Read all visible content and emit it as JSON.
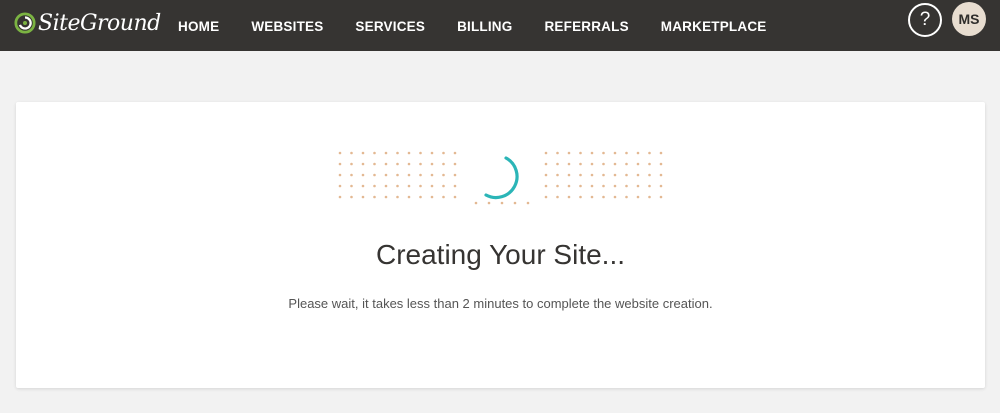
{
  "brand": {
    "name": "SiteGround",
    "logo_icon": "siteground-swirl-icon",
    "accent_color": "#7bb342"
  },
  "nav": {
    "items": [
      {
        "label": "HOME"
      },
      {
        "label": "WEBSITES"
      },
      {
        "label": "SERVICES"
      },
      {
        "label": "BILLING"
      },
      {
        "label": "REFERRALS"
      },
      {
        "label": "MARKETPLACE"
      }
    ]
  },
  "header": {
    "help_label": "?",
    "help_icon": "question-mark-icon",
    "avatar_initials": "MS"
  },
  "main": {
    "title": "Creating Your Site...",
    "message": "Please wait, it takes less than 2 minutes to complete the website creation.",
    "spinner_icon": "loading-spinner-icon",
    "spinner_color": "#2bb5b7",
    "dot_color": "#e3b892"
  }
}
